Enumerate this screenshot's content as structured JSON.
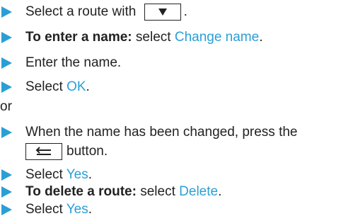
{
  "steps": [
    {
      "prefix": "Select a route with ",
      "key": "down-arrow",
      "suffix": "."
    },
    {
      "bold": "To enter a name:",
      "prefix": " select ",
      "link": "Change name",
      "suffix": "."
    },
    {
      "text": "Enter the name."
    },
    {
      "prefix": "Select ",
      "link": "OK",
      "suffix": "."
    },
    {
      "or": "or"
    },
    {
      "text1": "When the name has been changed, press the",
      "key": "back",
      "text2": "button."
    },
    {
      "prefix": "Select ",
      "link": "Yes",
      "suffix": "."
    },
    {
      "bold": "To delete a route:",
      "prefix": " select ",
      "link": "Delete",
      "suffix": "."
    },
    {
      "prefix": "Select ",
      "link": "Yes",
      "suffix": "."
    }
  ],
  "colors": {
    "accent": "#2a9fd6",
    "text": "#222222"
  },
  "icons": {
    "bullet": "triangle-right-icon",
    "down_key": "down-arrow-key-icon",
    "back_key": "back-key-icon"
  }
}
